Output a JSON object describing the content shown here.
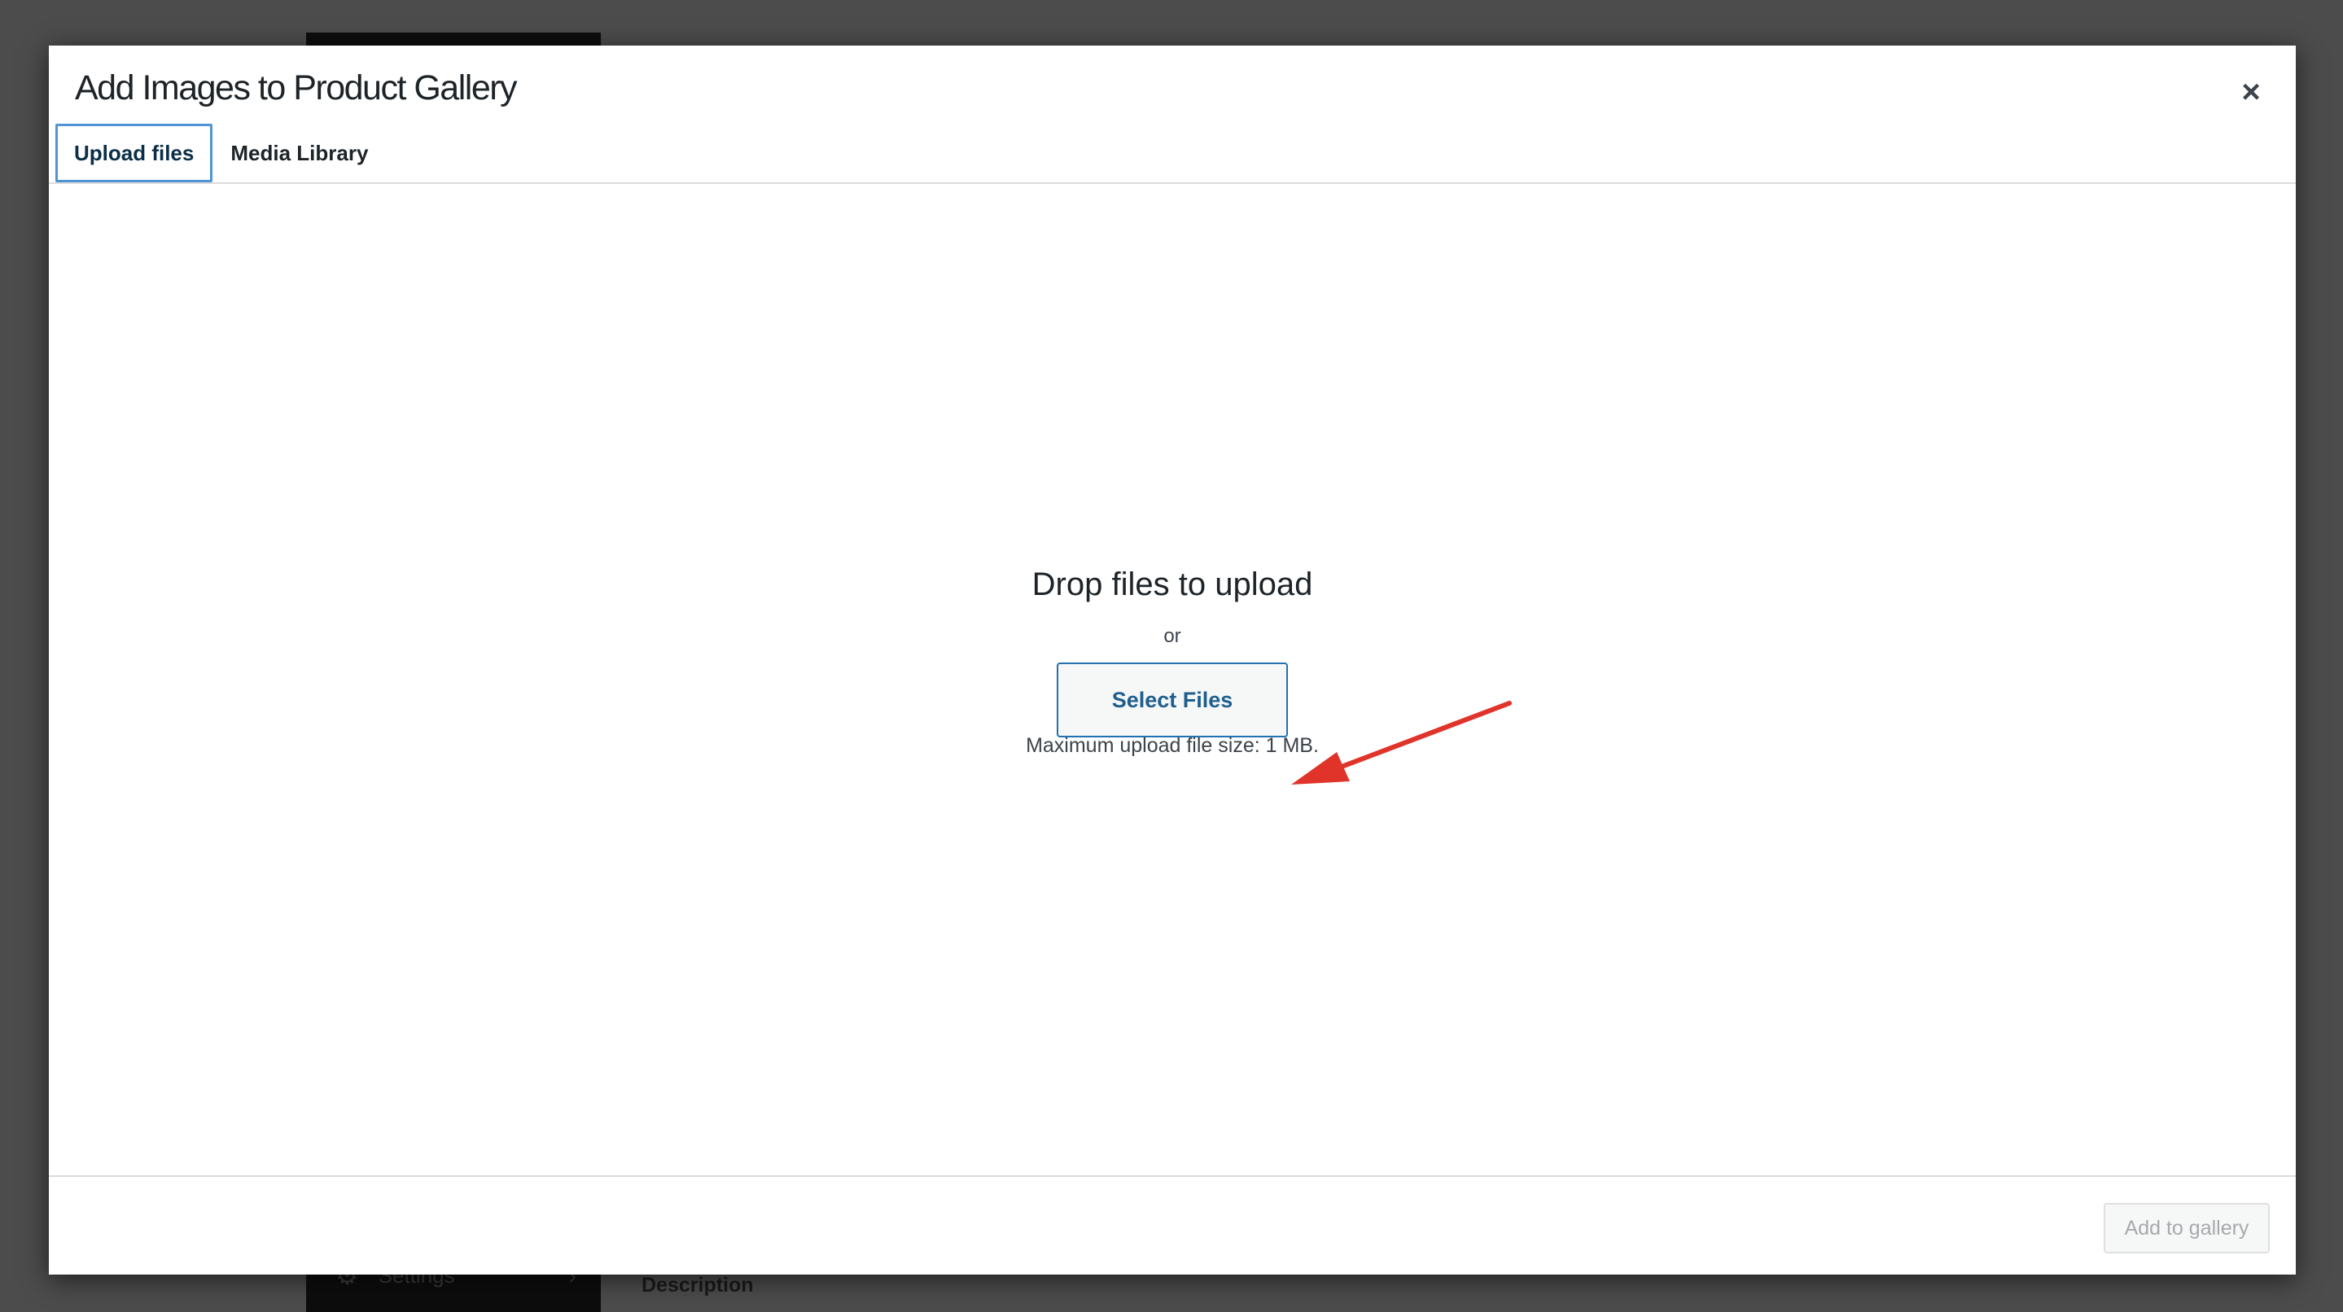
{
  "background": {
    "sidebar_item": "Settings",
    "sidebar_icon": "gear-icon",
    "content_label": "Description"
  },
  "modal": {
    "title": "Add Images to Product Gallery",
    "close_icon": "×",
    "tabs": [
      {
        "label": "Upload files",
        "active": true
      },
      {
        "label": "Media Library",
        "active": false
      }
    ],
    "upload": {
      "heading": "Drop files to upload",
      "or": "or",
      "select_button": "Select Files",
      "max_size": "Maximum upload file size: 1 MB."
    },
    "footer": {
      "add_button": "Add to gallery",
      "add_button_disabled": true
    }
  },
  "colors": {
    "accent": "#2271b1",
    "focus_border": "#4f94d4",
    "annotation_arrow": "#e0342b",
    "overlay": "#4c4c4c"
  }
}
